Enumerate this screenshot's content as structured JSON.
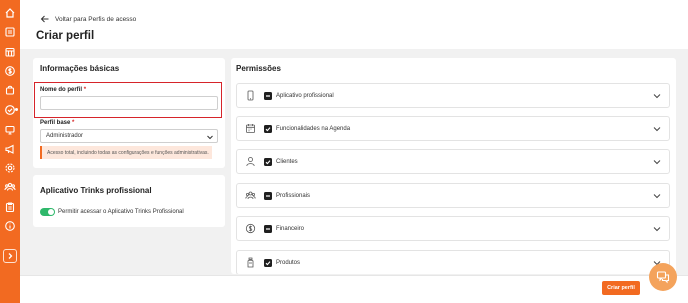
{
  "sidebar": {
    "icons": [
      "home-icon",
      "catalog-icon",
      "calendar-grid-icon",
      "dollar-icon",
      "bag-icon",
      "check-circle-icon",
      "monitor-icon",
      "megaphone-icon",
      "gear-icon",
      "users-icon",
      "clipboard-icon",
      "info-icon"
    ],
    "expand_icon": "chevron-right-icon",
    "accent": "#f26a21"
  },
  "header": {
    "back_label": "Voltar para Perfis de acesso",
    "title": "Criar perfil"
  },
  "basic_info": {
    "title": "Informações básicas",
    "name_label": "Nome do perfil",
    "name_value": "",
    "base_label": "Perfil base",
    "base_selected": "Administrador",
    "warning": "Acesso total, incluindo todas as configurações e funções administrativas.",
    "required_mark": "*"
  },
  "app_section": {
    "title": "Aplicativo Trinks profissional",
    "toggle_label": "Permitir acessar o Aplicativo Trinks Profissional",
    "toggle_on": true
  },
  "permissions": {
    "title": "Permissões",
    "items": [
      {
        "label": "Aplicativo profissional",
        "icon": "smartphone-icon",
        "state": "partial"
      },
      {
        "label": "Funcionalidades na Agenda",
        "icon": "calendar-icon",
        "state": "checked"
      },
      {
        "label": "Clientes",
        "icon": "user-icon",
        "state": "checked"
      },
      {
        "label": "Profissionais",
        "icon": "team-icon",
        "state": "partial"
      },
      {
        "label": "Financeiro",
        "icon": "dollar-icon",
        "state": "partial"
      },
      {
        "label": "Produtos",
        "icon": "bottle-icon",
        "state": "checked"
      }
    ]
  },
  "footer": {
    "create_label": "Criar perfil"
  },
  "chat": {
    "icon": "chat-icon"
  }
}
